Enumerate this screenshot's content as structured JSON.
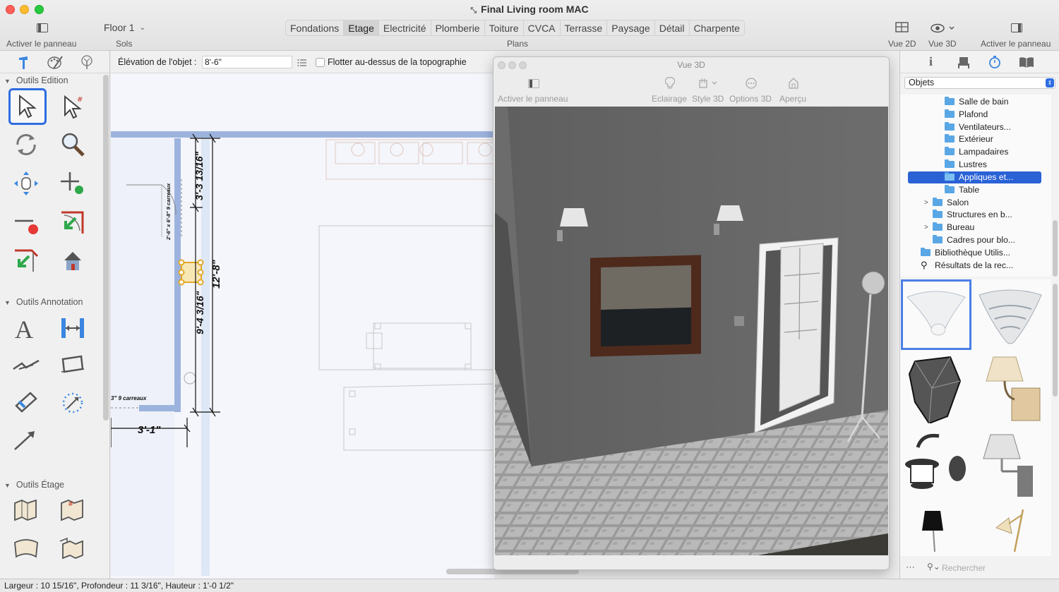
{
  "window": {
    "title": "Final Living room MAC",
    "toolbar": {
      "left_panel_label": "Activer le panneau",
      "floor_value": "Floor 1",
      "floor_label": "Sols",
      "plans_label": "Plans",
      "vue2d_label": "Vue 2D",
      "vue3d_label": "Vue 3D",
      "right_panel_label": "Activer le panneau",
      "tabs": [
        "Fondations",
        "Etage",
        "Electricité",
        "Plomberie",
        "Toiture",
        "CVCA",
        "Terrasse",
        "Paysage",
        "Détail",
        "Charpente"
      ],
      "active_tab": "Etage"
    }
  },
  "left_panel": {
    "sections": [
      {
        "title": "Outils Edition"
      },
      {
        "title": "Outils Annotation"
      },
      {
        "title": "Outils Étage"
      }
    ]
  },
  "plan_options": {
    "elevation_label": "Élévation de l'objet :",
    "elevation_value": "8'-6\"",
    "float_label": "Flotter au-dessus de la topographie"
  },
  "plan": {
    "dims": {
      "d1": "3'-3 13/16\"",
      "d2": "9'-4 3/16\"",
      "d3": "12'-8\"",
      "d4": "3'-1\""
    },
    "door_label": "2'-6\" x 6'-8\" 9 carreaux",
    "door_label2": "3\" 9 carreaux"
  },
  "view3d": {
    "title": "Vue 3D",
    "toggle_label": "Activer le panneau",
    "lighting_label": "Eclairage",
    "style_label": "Style 3D",
    "options_label": "Options 3D",
    "preview_label": "Aperçu"
  },
  "library": {
    "dropdown_value": "Objets",
    "tree": [
      {
        "label": "Salle de bain",
        "level": 2
      },
      {
        "label": "Plafond",
        "level": 2
      },
      {
        "label": "Ventilateurs...",
        "level": 2
      },
      {
        "label": "Extérieur",
        "level": 2
      },
      {
        "label": "Lampadaires",
        "level": 2
      },
      {
        "label": "Lustres",
        "level": 2
      },
      {
        "label": "Appliques et...",
        "level": 2,
        "selected": true
      },
      {
        "label": "Table",
        "level": 2
      },
      {
        "label": "Salon",
        "level": 1,
        "expandable": true
      },
      {
        "label": "Structures en b...",
        "level": 1
      },
      {
        "label": "Bureau",
        "level": 1,
        "expandable": true
      },
      {
        "label": "Cadres pour blo...",
        "level": 1
      },
      {
        "label": "Bibliothèque Utilis...",
        "level": 0
      },
      {
        "label": "Résultats de la rec...",
        "level": 0,
        "icon": "search"
      }
    ],
    "search_placeholder": "Rechercher"
  },
  "status": {
    "text": "Largeur : 10 15/16\", Profondeur : 11 3/16\", Hauteur : 1'-0 1/2\""
  },
  "colors": {
    "accent": "#2e6de0",
    "selection": "#2a62d6",
    "wall": "#8fa8d8",
    "wall_3d": "#6b6b6b"
  }
}
